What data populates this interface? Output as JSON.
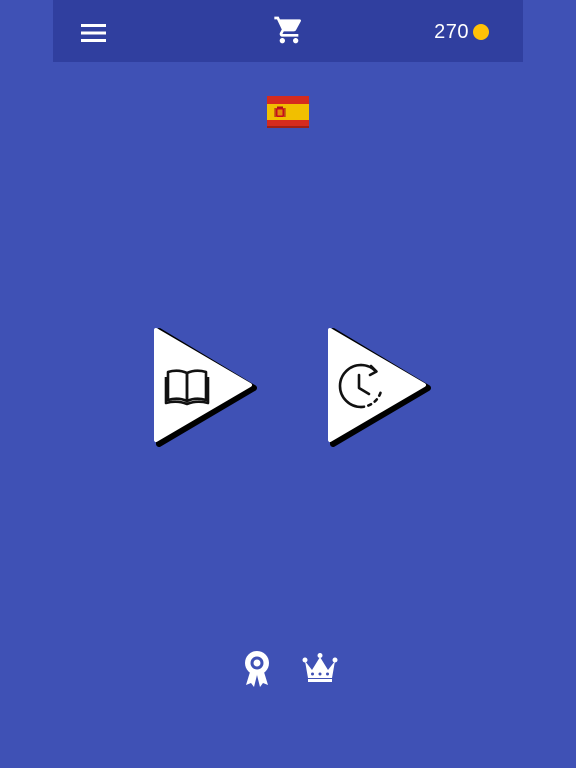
{
  "header": {
    "menu_icon": "hamburger-menu-icon",
    "cart_icon": "shopping-cart-icon",
    "coins": "270",
    "coin_icon": "coin-icon"
  },
  "language": {
    "flag_icon": "spain-flag-icon"
  },
  "modes": [
    {
      "icon": "open-book-icon"
    },
    {
      "icon": "timer-clock-icon"
    }
  ],
  "footer": {
    "achievements_icon": "award-ribbon-icon",
    "leaderboard_icon": "crown-icon"
  },
  "colors": {
    "background": "#3f51b5",
    "topbar": "#303f9f",
    "coin": "#ffc107",
    "flag_red": "#d52b1e",
    "flag_yellow": "#f1bf00",
    "button_fill": "#ffffff"
  }
}
